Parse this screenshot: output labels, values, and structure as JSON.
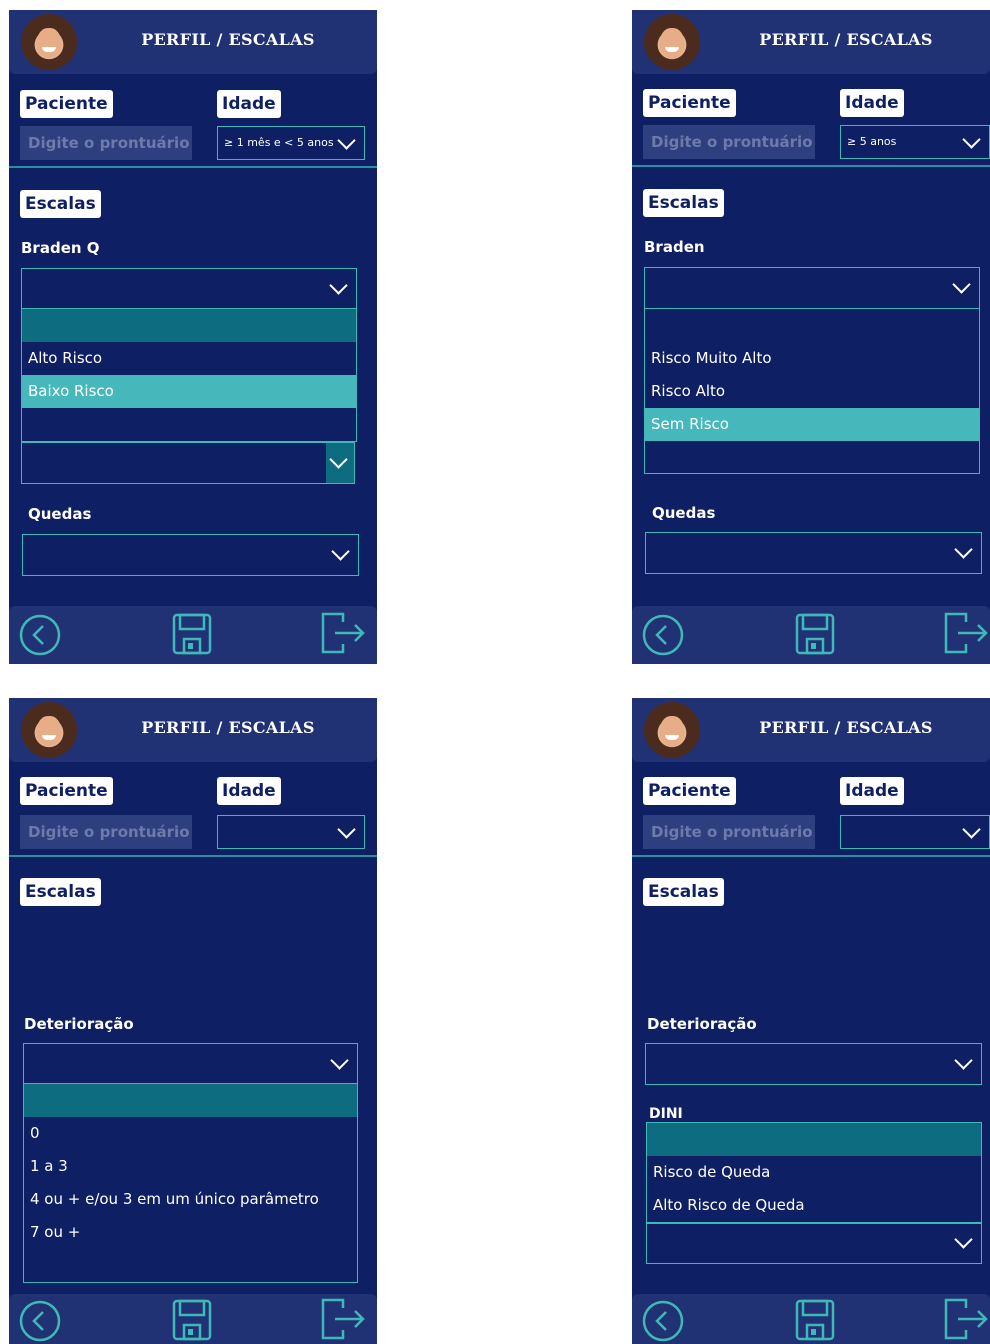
{
  "screens": [
    {
      "title": "PERFIL / ESCALAS",
      "paciente_label": "Paciente",
      "idade_label": "Idade",
      "prontuario_placeholder": "Digite o prontuário",
      "idade_value": "≥ 1 mês e < 5 anos",
      "escalas_label": "Escalas",
      "scale_label": "Braden Q",
      "options": [
        "",
        "Alto Risco",
        "Baixo Risco",
        ""
      ],
      "selected_option": "Baixo Risco",
      "quedas_label": "Quedas"
    },
    {
      "title": "PERFIL / ESCALAS",
      "paciente_label": "Paciente",
      "idade_label": "Idade",
      "prontuario_placeholder": "Digite o prontuário",
      "idade_value": "≥ 5 anos",
      "escalas_label": "Escalas",
      "scale_label": "Braden",
      "options": [
        "",
        "Risco Muito Alto",
        "Risco Alto",
        "Sem Risco",
        ""
      ],
      "selected_option": "Sem Risco",
      "quedas_label": "Quedas"
    },
    {
      "title": "PERFIL / ESCALAS",
      "paciente_label": "Paciente",
      "idade_label": "Idade",
      "prontuario_placeholder": "Digite o prontuário",
      "idade_value": "",
      "escalas_label": "Escalas",
      "scale_label": "Deterioração",
      "options": [
        "",
        "0",
        "1 a 3",
        "4 ou + e/ou 3 em um único parâmetro",
        "7 ou +"
      ]
    },
    {
      "title": "PERFIL / ESCALAS",
      "paciente_label": "Paciente",
      "idade_label": "Idade",
      "prontuario_placeholder": "Digite o prontuário",
      "idade_value": "",
      "escalas_label": "Escalas",
      "scale_label": "Deterioração",
      "dini_label": "DINI",
      "options": [
        "",
        "Risco de Queda",
        "Alto Risco de Queda"
      ]
    }
  ],
  "icons": {
    "back": "back-circle-icon",
    "save": "save-floppy-icon",
    "exit": "exit-arrow-icon"
  },
  "colors": {
    "background": "#0f1f63",
    "header": "#203274",
    "accent": "#3fb8b8",
    "selected": "#46b8bc",
    "blank_option": "#0e6c80"
  }
}
